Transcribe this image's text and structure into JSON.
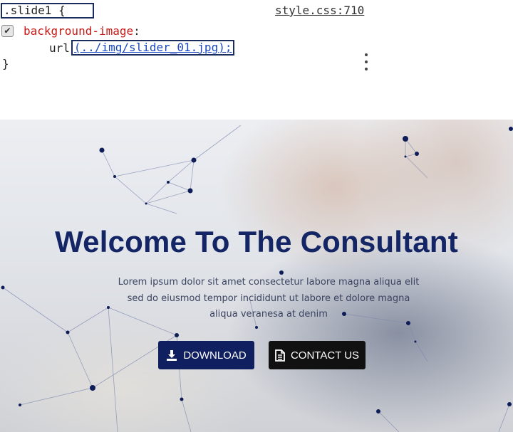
{
  "devtools": {
    "selector": ".slide1 {",
    "source_link": "style.css:710",
    "property": {
      "checked": true,
      "name": "background-image",
      "colon": ":",
      "value_prefix": "url",
      "url_text": "(../img/slider_01.jpg);",
      "closing_brace": "}"
    },
    "menu_icon": "more-vertical-icon"
  },
  "hero": {
    "title": "Welcome To The Consultant",
    "description": "Lorem ipsum dolor sit amet consectetur labore magna aliqua elit sed do eiusmod tempor incididunt ut labore et dolore magna aliqua veranesa at denim",
    "buttons": {
      "download": {
        "label": "DOWNLOAD",
        "icon": "download-icon"
      },
      "contact": {
        "label": "CONTACT US",
        "icon": "document-icon"
      }
    },
    "colors": {
      "title": "#142566",
      "download_button": "#0f1f60",
      "contact_button": "#111111",
      "network_dots": "#0e1d57"
    }
  }
}
